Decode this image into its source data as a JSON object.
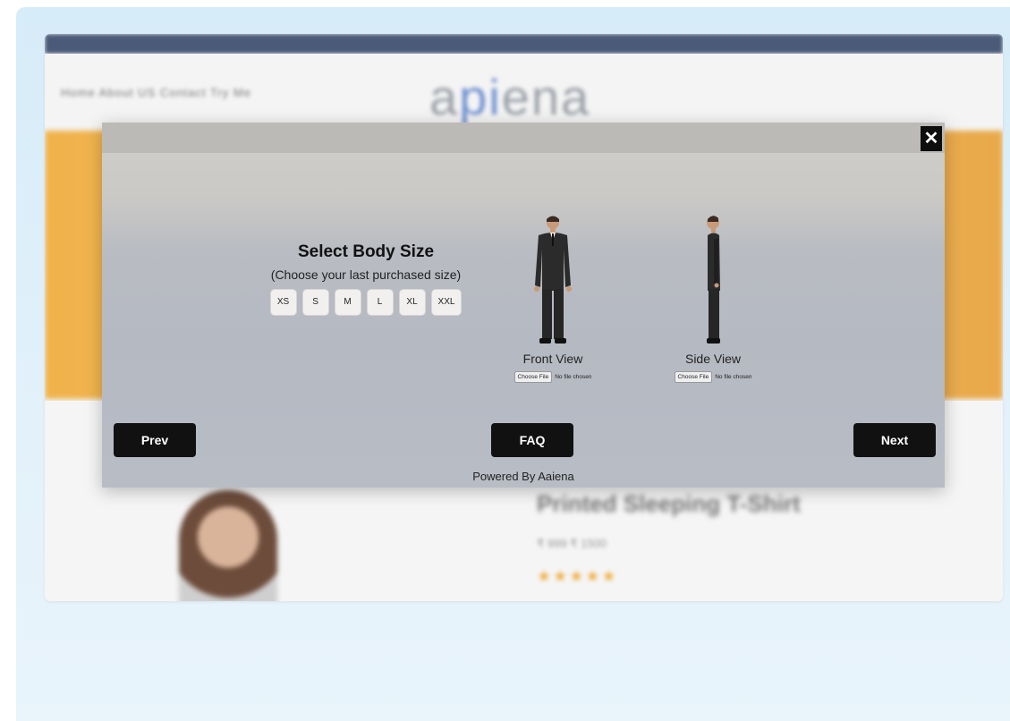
{
  "background_page": {
    "nav_text": "Home   About US   Contact   Try Me",
    "logo": {
      "pre": "a",
      "mid": "pi",
      "post": "ena"
    },
    "product_title": "Printed Sleeping T-Shirt",
    "price": "₹ 999     ₹ 1500",
    "stars": "★★★★★"
  },
  "modal": {
    "close_label": "✕",
    "size_title": "Select Body Size",
    "size_subtitle": "(Choose your last purchased size)",
    "sizes": [
      "XS",
      "S",
      "M",
      "L",
      "XL",
      "XXL"
    ],
    "front": {
      "label": "Front View",
      "choose_file": "Choose File",
      "no_file": "No file chosen"
    },
    "side": {
      "label": "Side View",
      "choose_file": "Choose File",
      "no_file": "No file chosen"
    },
    "prev_label": "Prev",
    "faq_label": "FAQ",
    "next_label": "Next",
    "powered_by": "Powered By Aaiena"
  }
}
